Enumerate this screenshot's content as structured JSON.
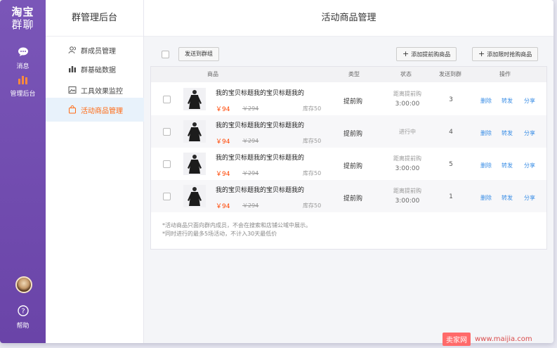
{
  "rail": {
    "logo_line1": "淘宝",
    "logo_line2": "群聊",
    "items": [
      {
        "label": "消息"
      },
      {
        "label": "管理后台"
      }
    ],
    "help_label": "帮助"
  },
  "subnav": {
    "title": "群管理后台",
    "items": [
      {
        "label": "群成员管理"
      },
      {
        "label": "群基础数据"
      },
      {
        "label": "工具效果监控"
      },
      {
        "label": "活动商品管理"
      }
    ]
  },
  "main": {
    "title": "活动商品管理",
    "toolbar": {
      "send_to_group": "发送到群组",
      "add_presale": "添加提前购商品",
      "add_flash": "添加限时抢购商品"
    },
    "table": {
      "headers": {
        "product": "商品",
        "type": "类型",
        "status": "状态",
        "sent_groups": "发送到群",
        "actions": "操作"
      },
      "rows": [
        {
          "name": "我的宝贝标题我的宝贝标题我的",
          "price": "￥94",
          "original": "￥294",
          "stock": "库存50",
          "type": "提前购",
          "status_line1": "距离提前购",
          "status_line2": "3:00:00",
          "count": "3",
          "delete": "删除",
          "forward": "转发",
          "share": "分享"
        },
        {
          "name": "我的宝贝标题我的宝贝标题我的",
          "price": "￥94",
          "original": "￥294",
          "stock": "库存50",
          "type": "提前购",
          "status_line1": "进行中",
          "status_line2": "",
          "count": "4",
          "delete": "删除",
          "forward": "转发",
          "share": "分享"
        },
        {
          "name": "我的宝贝标题我的宝贝标题我的",
          "price": "￥94",
          "original": "￥294",
          "stock": "库存50",
          "type": "提前购",
          "status_line1": "距离提前购",
          "status_line2": "3:00:00",
          "count": "5",
          "delete": "删除",
          "forward": "转发",
          "share": "分享"
        },
        {
          "name": "我的宝贝标题我的宝贝标题我的",
          "price": "￥94",
          "original": "￥294",
          "stock": "库存50",
          "type": "提前购",
          "status_line1": "距离提前购",
          "status_line2": "3:00:00",
          "count": "1",
          "delete": "删除",
          "forward": "转发",
          "share": "分享"
        }
      ]
    },
    "notes": [
      "*活动商品只面向群内成员，不会在搜索和店铺公域中展示。",
      "*同时进行的最多5场活动，不计入30天最低价"
    ]
  },
  "watermark": {
    "badge": "卖家网",
    "url": "www.maijia.com"
  },
  "colors": {
    "rail": "#6a44a8",
    "accent": "#ff6a13",
    "price": "#ff4400",
    "link": "#3a8ee6"
  }
}
